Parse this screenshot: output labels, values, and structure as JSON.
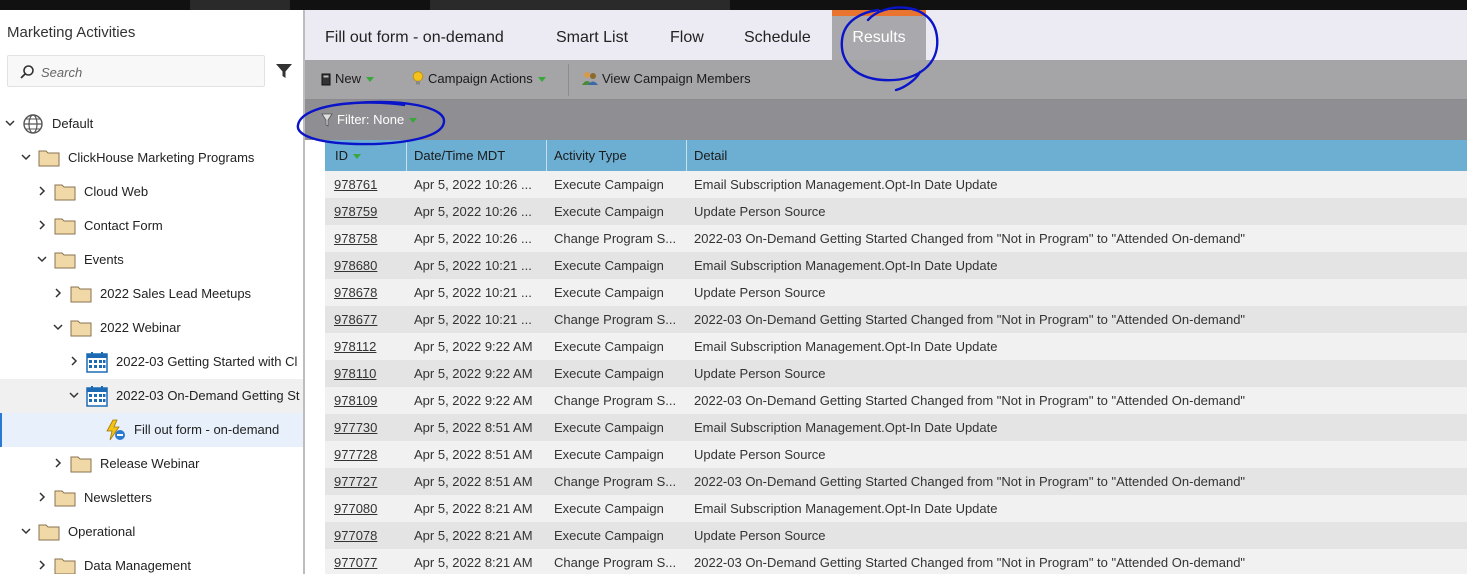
{
  "sidebar": {
    "title": "Marketing Activities",
    "search_placeholder": "Search",
    "tree": [
      {
        "label": "Default",
        "icon": "globe-icon",
        "expanded": true
      },
      {
        "label": "ClickHouse Marketing Programs",
        "icon": "folder-icon",
        "expanded": true
      },
      {
        "label": "Cloud Web",
        "icon": "folder-icon",
        "expanded": false
      },
      {
        "label": "Contact Form",
        "icon": "folder-icon",
        "expanded": false
      },
      {
        "label": "Events",
        "icon": "folder-icon",
        "expanded": true
      },
      {
        "label": "2022 Sales Lead Meetups",
        "icon": "folder-icon",
        "expanded": false
      },
      {
        "label": "2022 Webinar",
        "icon": "folder-icon",
        "expanded": true
      },
      {
        "label": "2022-03 Getting Started with Cl",
        "icon": "calendar-icon",
        "expanded": false
      },
      {
        "label": "2022-03 On-Demand Getting St",
        "icon": "calendar-icon",
        "expanded": true
      },
      {
        "label": "Fill out form - on-demand",
        "icon": "smart-campaign-icon",
        "selected": true
      },
      {
        "label": "Release Webinar",
        "icon": "folder-icon",
        "expanded": false
      },
      {
        "label": "Newsletters",
        "icon": "folder-icon",
        "expanded": false
      },
      {
        "label": "Operational",
        "icon": "folder-icon",
        "expanded": true
      },
      {
        "label": "Data Management",
        "icon": "folder-icon",
        "expanded": false
      }
    ]
  },
  "tabs": [
    {
      "label": "Fill out form - on-demand",
      "active": false
    },
    {
      "label": "Smart List",
      "active": false
    },
    {
      "label": "Flow",
      "active": false
    },
    {
      "label": "Schedule",
      "active": false
    },
    {
      "label": "Results",
      "active": true
    }
  ],
  "toolbar": {
    "new_label": "New",
    "campaign_actions_label": "Campaign Actions",
    "view_members_label": "View Campaign Members"
  },
  "filter": {
    "label": "Filter: None"
  },
  "table": {
    "headers": [
      "ID",
      "Date/Time MDT",
      "Activity Type",
      "Detail"
    ],
    "rows": [
      [
        "978761",
        "Apr 5, 2022 10:26 ...",
        "Execute Campaign",
        "Email Subscription Management.Opt-In Date Update"
      ],
      [
        "978759",
        "Apr 5, 2022 10:26 ...",
        "Execute Campaign",
        "Update Person Source"
      ],
      [
        "978758",
        "Apr 5, 2022 10:26 ...",
        "Change Program S...",
        "2022-03 On-Demand Getting Started Changed from \"Not in Program\" to \"Attended On-demand\""
      ],
      [
        "978680",
        "Apr 5, 2022 10:21 ...",
        "Execute Campaign",
        "Email Subscription Management.Opt-In Date Update"
      ],
      [
        "978678",
        "Apr 5, 2022 10:21 ...",
        "Execute Campaign",
        "Update Person Source"
      ],
      [
        "978677",
        "Apr 5, 2022 10:21 ...",
        "Change Program S...",
        "2022-03 On-Demand Getting Started Changed from \"Not in Program\" to \"Attended On-demand\""
      ],
      [
        "978112",
        "Apr 5, 2022 9:22 AM",
        "Execute Campaign",
        "Email Subscription Management.Opt-In Date Update"
      ],
      [
        "978110",
        "Apr 5, 2022 9:22 AM",
        "Execute Campaign",
        "Update Person Source"
      ],
      [
        "978109",
        "Apr 5, 2022 9:22 AM",
        "Change Program S...",
        "2022-03 On-Demand Getting Started Changed from \"Not in Program\" to \"Attended On-demand\""
      ],
      [
        "977730",
        "Apr 5, 2022 8:51 AM",
        "Execute Campaign",
        "Email Subscription Management.Opt-In Date Update"
      ],
      [
        "977728",
        "Apr 5, 2022 8:51 AM",
        "Execute Campaign",
        "Update Person Source"
      ],
      [
        "977727",
        "Apr 5, 2022 8:51 AM",
        "Change Program S...",
        "2022-03 On-Demand Getting Started Changed from \"Not in Program\" to \"Attended On-demand\""
      ],
      [
        "977080",
        "Apr 5, 2022 8:21 AM",
        "Execute Campaign",
        "Email Subscription Management.Opt-In Date Update"
      ],
      [
        "977078",
        "Apr 5, 2022 8:21 AM",
        "Execute Campaign",
        "Update Person Source"
      ],
      [
        "977077",
        "Apr 5, 2022 8:21 AM",
        "Change Program S...",
        "2022-03 On-Demand Getting Started Changed from \"Not in Program\" to \"Attended On-demand\""
      ]
    ]
  },
  "colors": {
    "accent_orange": "#e8742f",
    "header_blue": "#6cafd3",
    "annotation_blue": "#0a14c8"
  }
}
